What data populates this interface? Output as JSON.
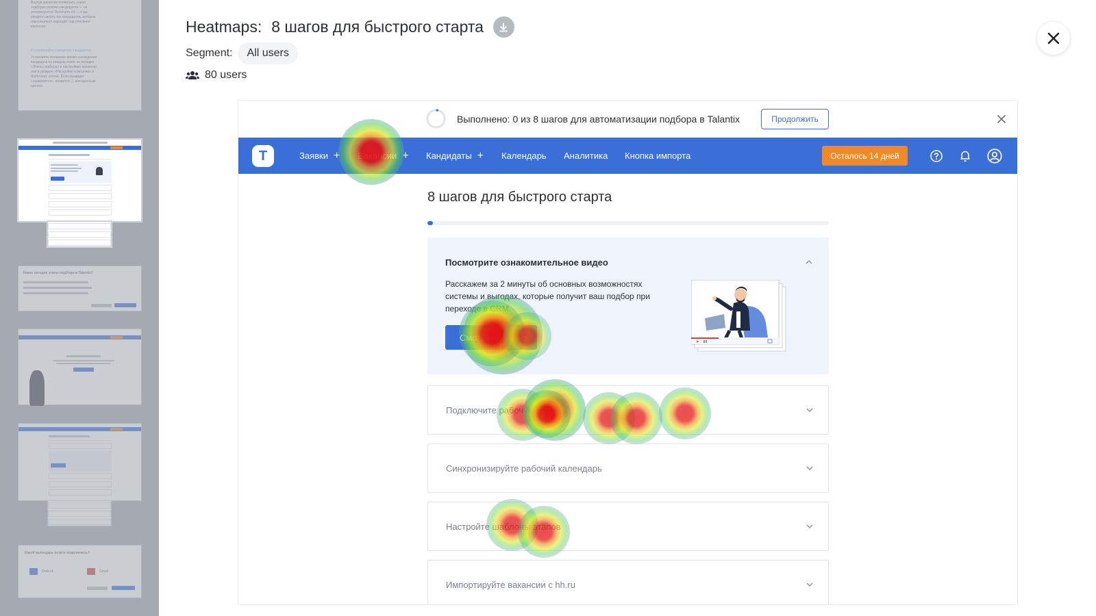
{
  "header": {
    "title_label": "Heatmaps:",
    "title": "8 шагов для быстрого старта",
    "segment_label": "Segment:",
    "segment_value": "All users",
    "users_count": "80 users"
  },
  "icons": {
    "download": "download-icon",
    "close": "close-icon",
    "users": "users-icon"
  },
  "filmstrip": {
    "thumb1_lines": [
      "Внутри вакансии появилась новая",
      "подборка резюме кандидатов — не",
      "интересуются. Включите её — и мы",
      "увидите сверху тех кандидатов, которые",
      "максимально подходят под описание",
      "вакансии."
    ],
    "thumb1_link": "Отслеживайте поведение кандидатов",
    "thumb1_lines2": [
      "Установите желаемое время нахождения",
      "кандидата на каждом этапе: во вкладке",
      "«Этапы подбора» в настройках вакансии",
      "или в разделе «Настройки компании» в",
      "Шаблонах этапов. Если кандидат",
      "«задержится», появится ⓘ или красным",
      "цветом."
    ],
    "thumb3_title": "Какие сегодня этапы подбора в Talantix?",
    "thumb6_title": "Какой календарь хотите подключить?",
    "thumb6_opt1": "Outlook",
    "thumb6_opt2": "Gmail"
  },
  "site": {
    "promo_text": "Выполнено: 0 из 8 шагов для автоматизации подбора в Talantix",
    "promo_button": "Продолжить",
    "logo": "T",
    "nav": [
      "Заявки",
      "Вакансии",
      "Кандидаты",
      "Календарь",
      "Аналитика",
      "Кнопка импорта"
    ],
    "trial": "Осталось 14 дней",
    "page_title": "8 шагов для быстрого старта",
    "progress": 0.01,
    "open_step": {
      "title": "Посмотрите ознакомительное видео",
      "desc": "Расскажем за 2 минуты об основных возможностях системы и выгодах, которые получит ваш подбор при переходе в CRM.",
      "button": "Смотреть видео"
    },
    "steps": [
      "Подключите рабочую почту",
      "Синхронизируйте рабочий календарь",
      "Настройте шаблоны этапов",
      "Импортируйте вакансии с hh.ru"
    ]
  },
  "colors": {
    "accent": "#3b6fd8",
    "trial": "#f08a26",
    "sidebar_bg": "#a5aab2"
  }
}
